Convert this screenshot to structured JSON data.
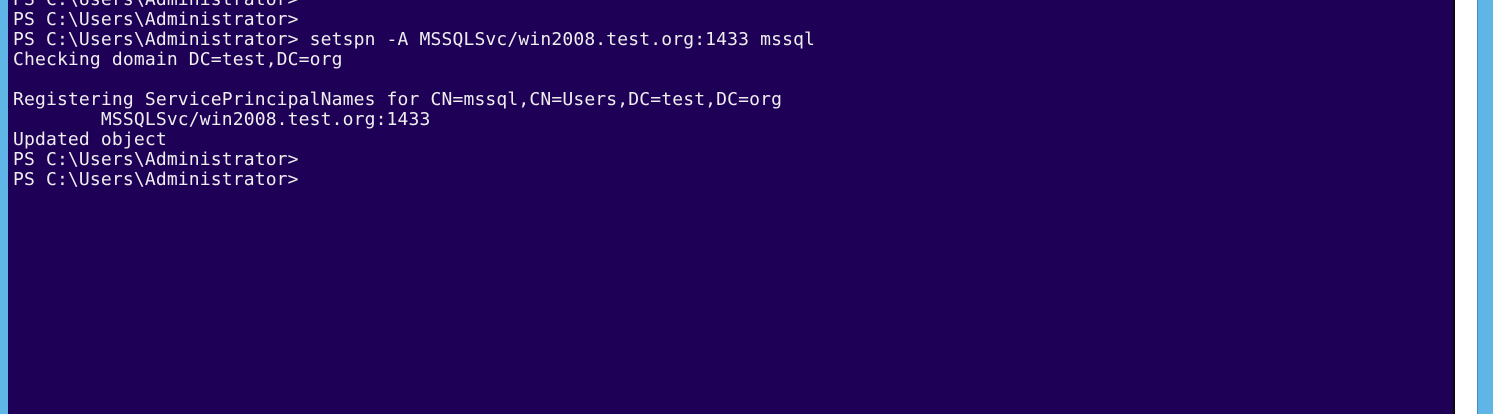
{
  "console": {
    "lines": [
      "PS C:\\Users\\Administrator>",
      "PS C:\\Users\\Administrator>",
      "PS C:\\Users\\Administrator> setspn -A MSSQLSvc/win2008.test.org:1433 mssql",
      "Checking domain DC=test,DC=org",
      "",
      "Registering ServicePrincipalNames for CN=mssql,CN=Users,DC=test,DC=org",
      "        MSSQLSvc/win2008.test.org:1433",
      "Updated object",
      "PS C:\\Users\\Administrator>",
      "PS C:\\Users\\Administrator>"
    ]
  },
  "colors": {
    "console_background": "#1f0057",
    "console_text": "#eeeeee",
    "window_frame": "#5fb6e6",
    "scrollbar_track": "#ffffff"
  }
}
